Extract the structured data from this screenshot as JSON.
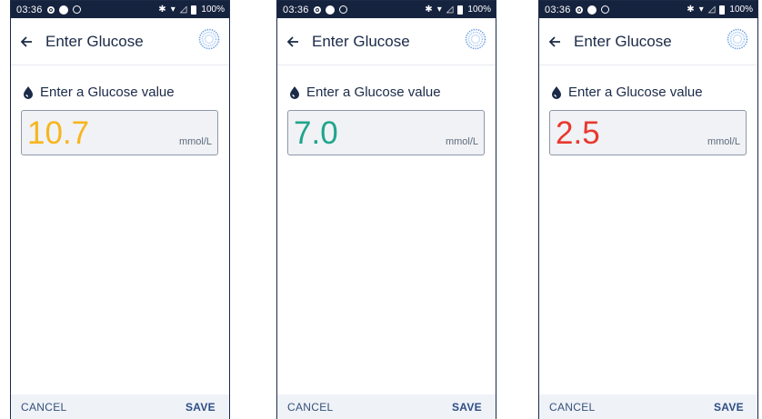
{
  "status_bar": {
    "time": "03:36",
    "battery": "100%"
  },
  "app_bar": {
    "title": "Enter Glucose"
  },
  "prompt": {
    "text": "Enter a Glucose value"
  },
  "footer": {
    "cancel_label": "CANCEL",
    "save_label": "SAVE"
  },
  "screens": [
    {
      "glucose_value": "10.7",
      "unit": "mmol/L",
      "value_color": "#f7b51e",
      "value_state": "high"
    },
    {
      "glucose_value": "7.0",
      "unit": "mmol/L",
      "value_color": "#1fa58c",
      "value_state": "in-range"
    },
    {
      "glucose_value": "2.5",
      "unit": "mmol/L",
      "value_color": "#e9382f",
      "value_state": "low"
    }
  ],
  "icons": {
    "back": "arrow-left-icon",
    "activity": "pod-status-icon",
    "drop": "blood-drop-icon"
  }
}
